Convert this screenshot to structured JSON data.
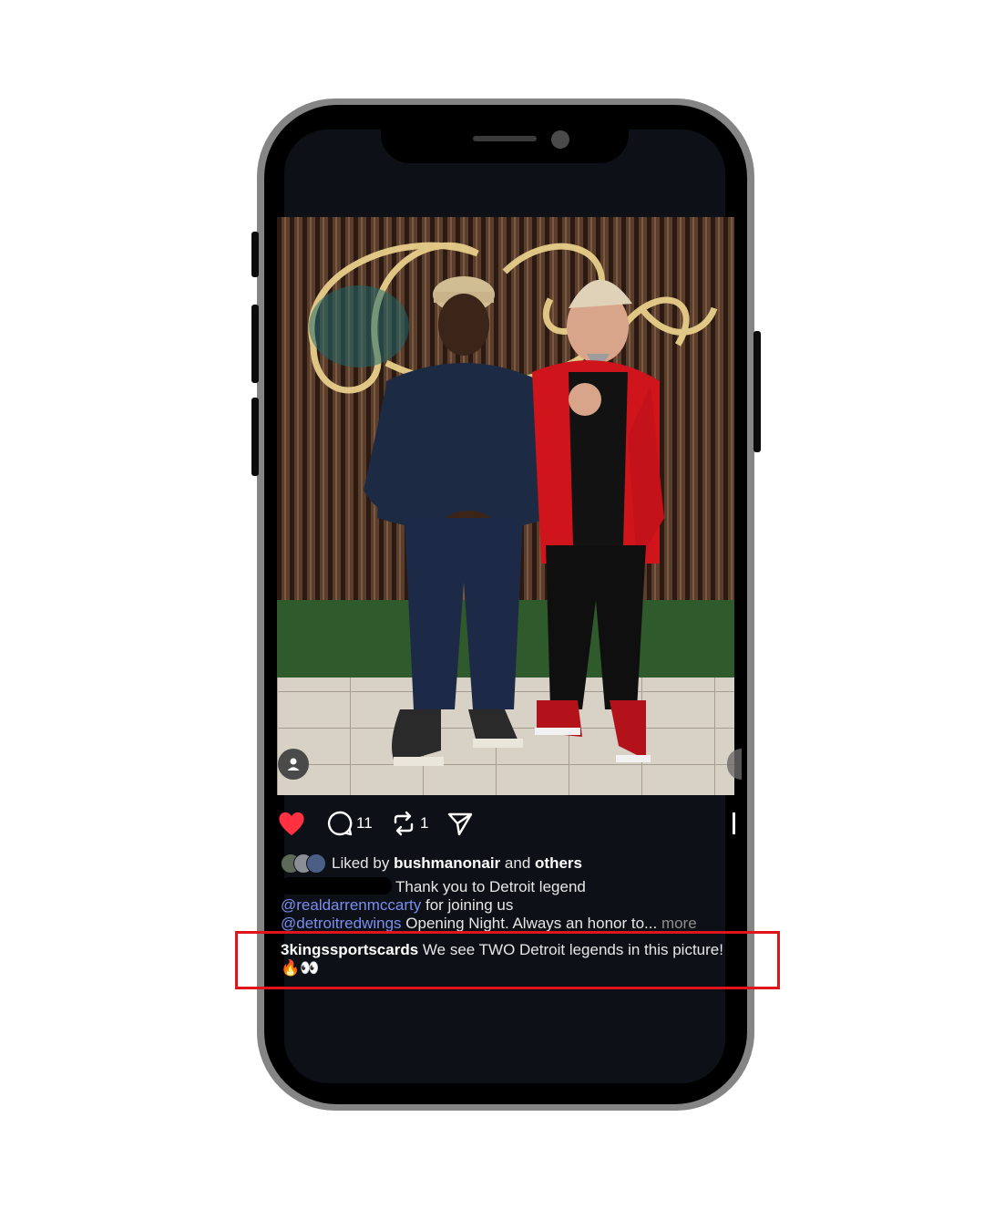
{
  "post": {
    "actions": {
      "comment_count": "11",
      "repost_count": "1",
      "liked": true,
      "heart_color": "#ff3040"
    },
    "likes": {
      "prefix": "Liked by",
      "user": "bushmanonair",
      "joiner": "and",
      "others": "others"
    },
    "caption": {
      "text_1": "Thank you to Detroit legend",
      "mention_1": "@realdarrenmccarty",
      "text_2": " for joining us",
      "mention_2": "@detroitredwings",
      "text_3": " Opening Night. Always an honor to...",
      "more": " more"
    },
    "highlighted_comment": {
      "username": "3kingssportscards",
      "text": " We see TWO Detroit legends in this picture! 🔥👀"
    },
    "highlight_color": "#e0141b"
  }
}
